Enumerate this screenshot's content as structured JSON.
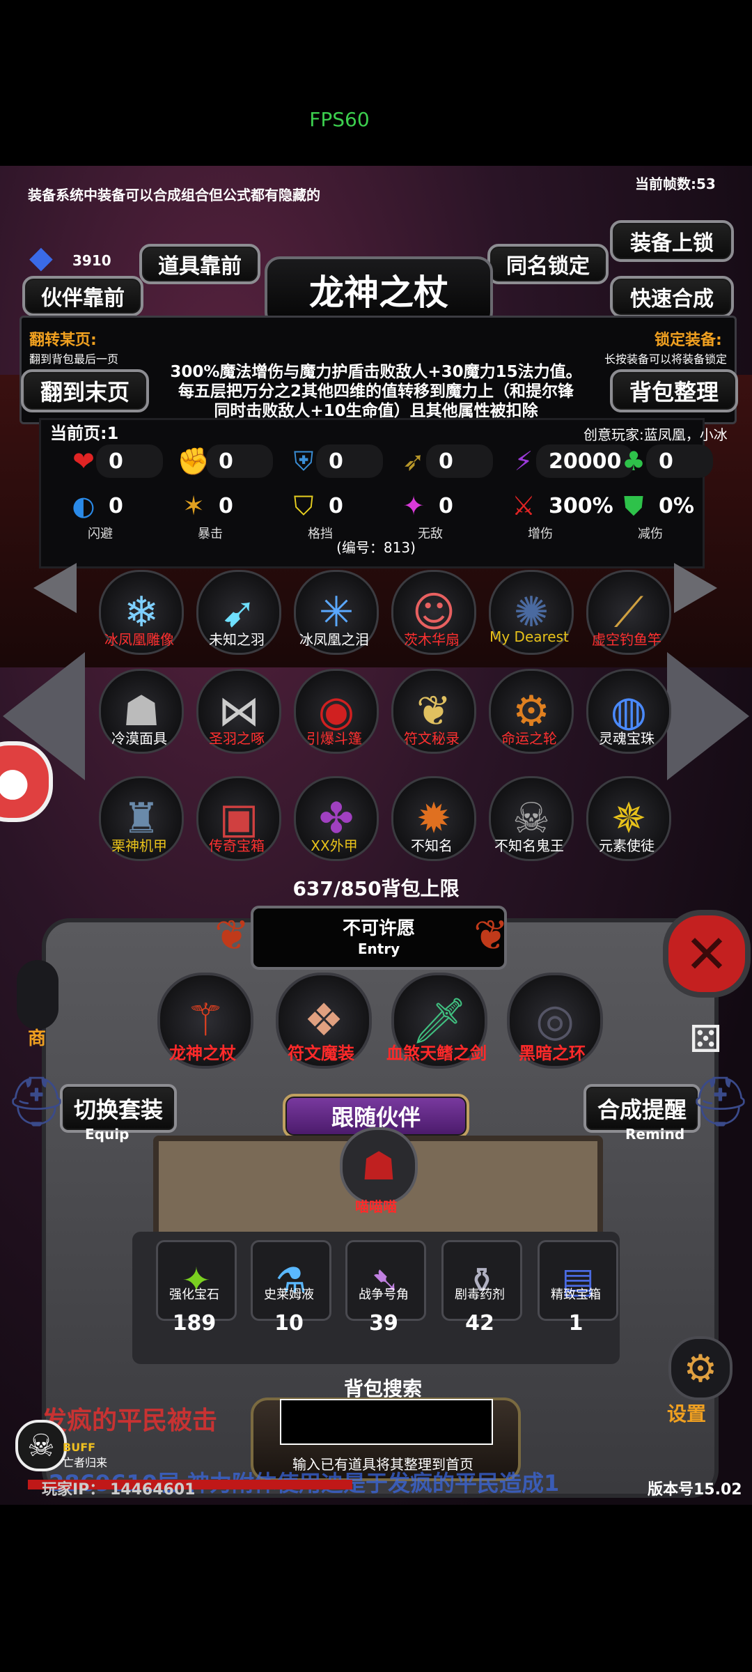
{
  "status": {
    "fps": "FPS60"
  },
  "top": {
    "tip": "装备系统中装备可以合成组合但公式都有隐藏的",
    "frame_count": "当前帧数:53",
    "gem_count": "3910"
  },
  "buttons": {
    "items_front": "道具靠前",
    "partner_front": "伙伴靠前",
    "same_name_lock": "同名锁定",
    "equip_lock": "装备上锁",
    "quick_merge": "快速合成",
    "to_last_page": "翻到末页",
    "bag_sort": "背包整理",
    "switch_set": "切换套装",
    "switch_set_sub": "Equip",
    "merge_hint": "合成提醒",
    "merge_hint_sub": "Remind",
    "follow_partner": "跟随伙伴",
    "close": "close"
  },
  "item": {
    "name": "龙神之杖",
    "flip_title": "翻转某页:",
    "flip_sub": "翻到背包最后一页",
    "lock_title": "锁定装备:",
    "lock_sub": "长按装备可以将装备锁定",
    "desc1": "300%魔法增伤与魔力护盾击败敌人+30魔力15法力值。",
    "desc2": "每五层把万分之2其他四维的值转移到魔力上（和提尔锋",
    "desc3": "同时击败敌人+10生命值）且其他属性被扣除",
    "current_page": "当前页:1",
    "creator": "创意玩家:蓝凤凰，小冰",
    "code": "(编号：813)"
  },
  "stats_row1": [
    {
      "icon": "heart-icon",
      "glyph": "❤",
      "color": "#e02424",
      "value": "0"
    },
    {
      "icon": "strength-icon",
      "glyph": "✊",
      "color": "#e8c21a",
      "value": "0"
    },
    {
      "icon": "armor-icon",
      "glyph": "⛨",
      "color": "#3a8fd8",
      "value": "0"
    },
    {
      "icon": "speed-icon",
      "glyph": "➶",
      "color": "#b8972a",
      "value": "0"
    },
    {
      "icon": "magic-icon",
      "glyph": "⚡",
      "color": "#9b3ad8",
      "value": "20000"
    },
    {
      "icon": "luck-icon",
      "glyph": "♣",
      "color": "#2ec24a",
      "value": "0"
    }
  ],
  "stats_row2": [
    {
      "icon": "dodge-icon",
      "glyph": "◐",
      "color": "#2a8ae8",
      "value": "0",
      "label": "闪避"
    },
    {
      "icon": "crit-icon",
      "glyph": "✶",
      "color": "#e0a020",
      "value": "0",
      "label": "暴击"
    },
    {
      "icon": "block-icon",
      "glyph": "⛉",
      "color": "#e8d020",
      "value": "0",
      "label": "格挡"
    },
    {
      "icon": "invincible-icon",
      "glyph": "✦",
      "color": "#d83ad8",
      "value": "0",
      "label": "无敌"
    },
    {
      "icon": "damage-up-icon",
      "glyph": "⚔",
      "color": "#e02424",
      "value": "300%",
      "label": "增伤"
    },
    {
      "icon": "damage-down-icon",
      "glyph": "⛊",
      "color": "#2ec24a",
      "value": "0%",
      "label": "减伤"
    }
  ],
  "grid": [
    {
      "label": "冰凤凰雕像",
      "glyph": "❄",
      "color": "#7fd0ff",
      "lblcolor": "#ff3030"
    },
    {
      "label": "未知之羽",
      "glyph": "➹",
      "color": "#6fe0ff",
      "lblcolor": "#ffffff"
    },
    {
      "label": "冰凤凰之泪",
      "glyph": "✳",
      "color": "#5aa8ff",
      "lblcolor": "#ffffff"
    },
    {
      "label": "茨木华扇",
      "glyph": "☺",
      "color": "#e86060",
      "lblcolor": "#ff3030"
    },
    {
      "label": "My Dearest",
      "glyph": "✺",
      "color": "#4a6aa0",
      "lblcolor": "#e8c21a"
    },
    {
      "label": "虚空钓鱼竿",
      "glyph": "⟋",
      "color": "#d0a040",
      "lblcolor": "#ff3030"
    },
    {
      "label": "冷漠面具",
      "glyph": "☗",
      "color": "#bbbbbb",
      "lblcolor": "#ffffff"
    },
    {
      "label": "圣羽之啄",
      "glyph": "⋈",
      "color": "#cccccc",
      "lblcolor": "#ff3030"
    },
    {
      "label": "引爆斗篷",
      "glyph": "◉",
      "color": "#d02020",
      "lblcolor": "#ff3030"
    },
    {
      "label": "符文秘录",
      "glyph": "❦",
      "color": "#e0c060",
      "lblcolor": "#ff3030"
    },
    {
      "label": "命运之轮",
      "glyph": "⚙",
      "color": "#e08020",
      "lblcolor": "#ff3030"
    },
    {
      "label": "灵魂宝珠",
      "glyph": "◍",
      "color": "#4a8aff",
      "lblcolor": "#ffffff"
    },
    {
      "label": "栗神机甲",
      "glyph": "♜",
      "color": "#6a8aaa",
      "lblcolor": "#e8c21a"
    },
    {
      "label": "传奇宝箱",
      "glyph": "▣",
      "color": "#d04040",
      "lblcolor": "#ff3030"
    },
    {
      "label": "XX外甲",
      "glyph": "✤",
      "color": "#a040c0",
      "lblcolor": "#e8c21a"
    },
    {
      "label": "不知名",
      "glyph": "✹",
      "color": "#e07020",
      "lblcolor": "#ffffff"
    },
    {
      "label": "不知名鬼王",
      "glyph": "☠",
      "color": "#aaaaaa",
      "lblcolor": "#ffffff"
    },
    {
      "label": "元素使徒",
      "glyph": "✵",
      "color": "#e8c21a",
      "lblcolor": "#ffffff"
    }
  ],
  "bag": {
    "capacity": "637/850背包上限",
    "wish": "不可许愿",
    "wish_sub": "Entry",
    "shop": "商",
    "set": "设置"
  },
  "wishes": [
    {
      "label": "龙神之杖",
      "glyph": "⚚",
      "color": "#e04020"
    },
    {
      "label": "符文魔装",
      "glyph": "❖",
      "color": "#e0a080"
    },
    {
      "label": "血煞天鳍之剑",
      "glyph": "🗡",
      "color": "#40c080"
    },
    {
      "label": "黑暗之环",
      "glyph": "◎",
      "color": "#555566"
    }
  ],
  "partner": {
    "name": "喵喵喵",
    "glyph": "☗"
  },
  "consumables": [
    {
      "label": "强化宝石",
      "glyph": "✦",
      "color": "#7ad020",
      "count": "189"
    },
    {
      "label": "史莱姆液",
      "glyph": "⚗",
      "color": "#5ab8ff",
      "count": "10"
    },
    {
      "label": "战争号角",
      "glyph": "➷",
      "color": "#c080e0",
      "count": "39"
    },
    {
      "label": "剧毒药剂",
      "glyph": "⚱",
      "color": "#b0b0c0",
      "count": "42"
    },
    {
      "label": "精致宝箱",
      "glyph": "▤",
      "color": "#4a6ae0",
      "count": "1"
    }
  ],
  "search": {
    "title": "背包搜索",
    "placeholder": "",
    "hint": "输入已有道具将其整理到首页"
  },
  "footer": {
    "scroll_msg": "发疯的平民被击",
    "scroll_msg2": "2869610层 神力附体使用迪是于发疯的平民造成1",
    "buff": "BUFF",
    "buff_sub": "亡者归来",
    "player_ip": "玩家IP：  14464601",
    "version": "版本号15.02"
  }
}
